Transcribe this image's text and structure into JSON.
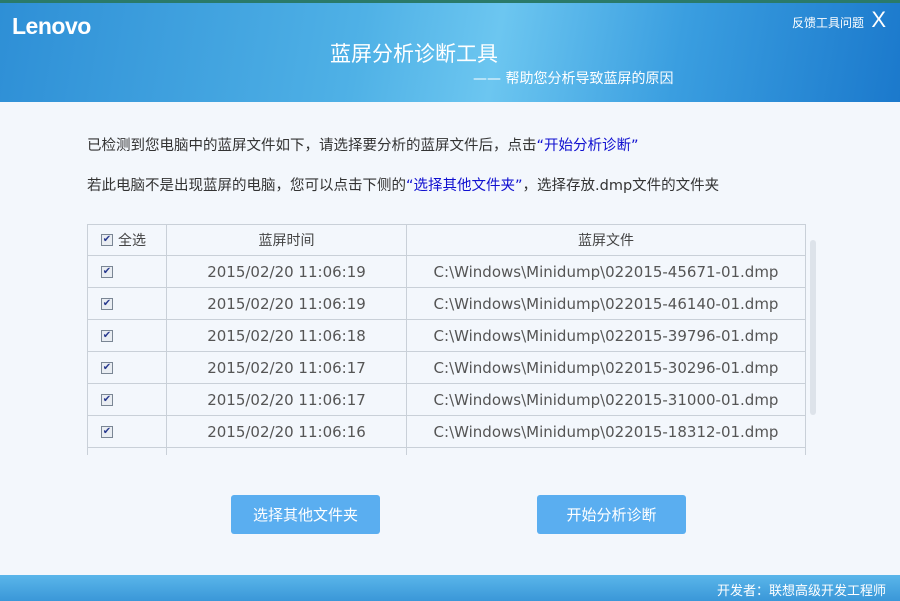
{
  "header": {
    "logo": "Lenovo",
    "feedback": "反馈工具问题",
    "close": "X",
    "title": "蓝屏分析诊断工具",
    "subtitle": "—— 帮助您分析导致蓝屏的原因"
  },
  "instructions": {
    "line1_pre": "已检测到您电脑中的蓝屏文件如下，请选择要分析的蓝屏文件后，点击",
    "line1_hl": "“开始分析诊断”",
    "line2_pre": "若此电脑不是出现蓝屏的电脑，您可以点击下侧的",
    "line2_hl": "“选择其他文件夹”",
    "line2_post": "，选择存放.dmp文件的文件夹"
  },
  "table": {
    "headers": [
      "全选",
      "蓝屏时间",
      "蓝屏文件"
    ],
    "select_all": true,
    "rows": [
      {
        "checked": true,
        "time": "2015/02/20 11:06:19",
        "file": "C:\\Windows\\Minidump\\022015-45671-01.dmp"
      },
      {
        "checked": true,
        "time": "2015/02/20 11:06:19",
        "file": "C:\\Windows\\Minidump\\022015-46140-01.dmp"
      },
      {
        "checked": true,
        "time": "2015/02/20 11:06:18",
        "file": "C:\\Windows\\Minidump\\022015-39796-01.dmp"
      },
      {
        "checked": true,
        "time": "2015/02/20 11:06:17",
        "file": "C:\\Windows\\Minidump\\022015-30296-01.dmp"
      },
      {
        "checked": true,
        "time": "2015/02/20 11:06:17",
        "file": "C:\\Windows\\Minidump\\022015-31000-01.dmp"
      },
      {
        "checked": true,
        "time": "2015/02/20 11:06:16",
        "file": "C:\\Windows\\Minidump\\022015-18312-01.dmp"
      }
    ]
  },
  "buttons": {
    "other_folder": "选择其他文件夹",
    "start": "开始分析诊断"
  },
  "footer": {
    "developer": "开发者：联想高级开发工程师"
  }
}
